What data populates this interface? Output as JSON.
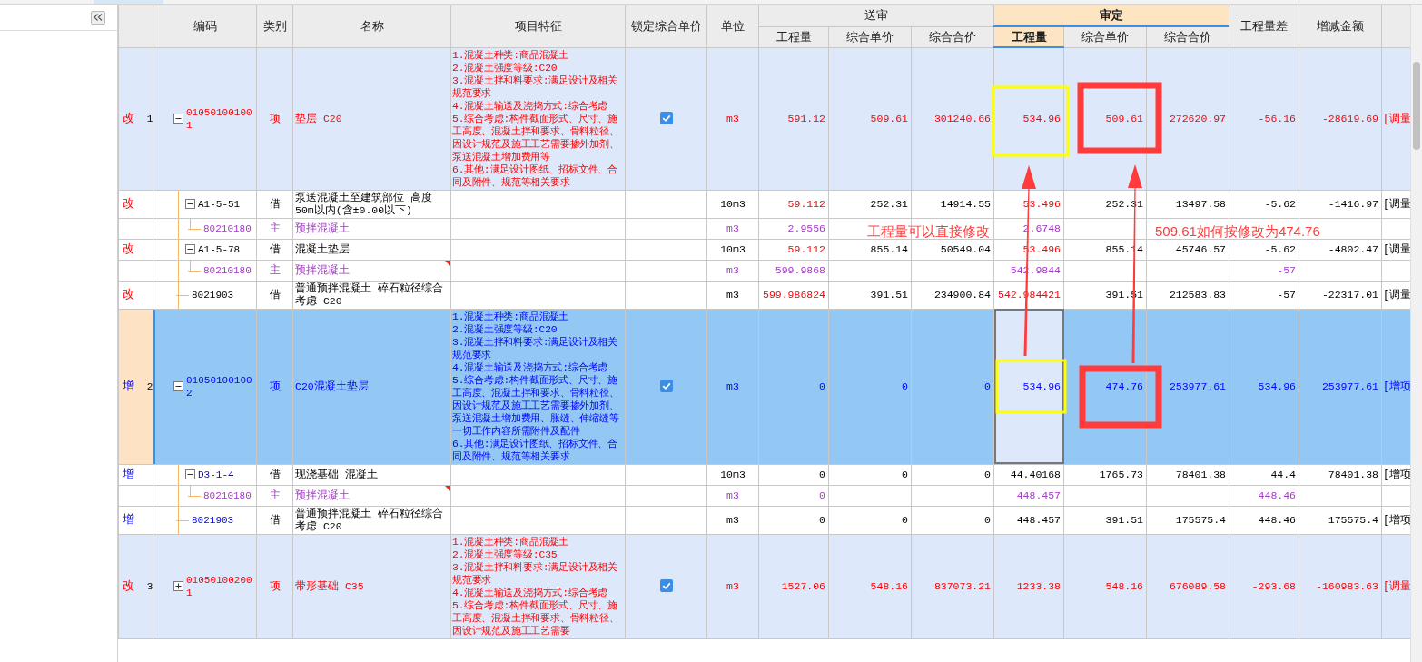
{
  "table": {
    "header": [
      {
        "kind": "single",
        "label": "编码"
      },
      {
        "kind": "single",
        "label": "类别"
      },
      {
        "kind": "single",
        "label": "名称"
      },
      {
        "kind": "single",
        "label": "项目特征"
      },
      {
        "kind": "single",
        "label": "锁定综合单价"
      },
      {
        "kind": "single",
        "label": "单位"
      },
      {
        "kind": "group",
        "label": "送审",
        "selected": false,
        "columns": [
          {
            "label": "工程量",
            "selected": false
          },
          {
            "label": "综合单价",
            "selected": false
          },
          {
            "label": "综合合价",
            "selected": false
          }
        ]
      },
      {
        "kind": "group",
        "label": "审定",
        "selected": true,
        "columns": [
          {
            "label": "工程量",
            "selected": true
          },
          {
            "label": "综合单价",
            "selected": false
          },
          {
            "label": "综合合价",
            "selected": false
          }
        ]
      },
      {
        "kind": "single",
        "label": "工程量差"
      },
      {
        "kind": "single",
        "label": "增减金额"
      }
    ],
    "rows": [
      {
        "kind": "item",
        "added": false,
        "mark": "改",
        "number": "1",
        "code": "010501001001",
        "type": "项",
        "name": "垫层 C20",
        "features": "1.混凝土种类:商品混凝土\n2.混凝土强度等级:C20\n3.混凝土拌和料要求:满足设计及相关规范要求\n4.混凝土输送及浇捣方式:综合考虑\n5.综合考虑:构件截面形式、尺寸、施工高度、混凝土拌和要求、骨料粒径、因设计规范及施工工艺需要掺外加剂、泵送混凝土增加费用等\n6.其他:满足设计图纸、招标文件、合同及附件、规范等相关要求",
        "locked": true,
        "unit": "m3",
        "values": {
          "review_qty": "591.12",
          "review_price": "509.61",
          "review_total": "301240.66",
          "approved_qty": "534.96",
          "approved_price": "509.61",
          "approved_total": "272620.97",
          "qty_diff": "-56.16",
          "amount_diff": "-28619.69"
        },
        "note": "[调量",
        "selected": false,
        "expanded": true,
        "children": [
          {
            "kind": "quota",
            "added": false,
            "mark": "改",
            "code": "A1-5-51",
            "type": "借",
            "name": "泵送混凝土至建筑部位 高度50m以内(含±0.00以下)",
            "unit": "10m3",
            "qty_changed": true,
            "values": {
              "review_qty": "59.112",
              "review_price": "252.31",
              "review_total": "14914.55",
              "approved_qty": "53.496",
              "approved_price": "252.31",
              "approved_total": "13497.58",
              "qty_diff": "-5.62",
              "amount_diff": "-1416.97"
            },
            "note": "[调量",
            "expanded": true,
            "children": [
              {
                "kind": "material",
                "code": "80210180",
                "type": "主",
                "name": "预拌混凝土",
                "unit": "m3",
                "values": {
                  "review_qty": "2.9556",
                  "approved_qty": "2.6748"
                }
              }
            ]
          },
          {
            "kind": "quota",
            "added": false,
            "mark": "改",
            "code": "A1-5-78",
            "type": "借",
            "name": "混凝土垫层",
            "unit": "10m3",
            "qty_changed": true,
            "values": {
              "review_qty": "59.112",
              "review_price": "855.14",
              "review_total": "50549.04",
              "approved_qty": "53.496",
              "approved_price": "855.14",
              "approved_total": "45746.57",
              "qty_diff": "-5.62",
              "amount_diff": "-4802.47"
            },
            "note": "[调量",
            "expanded": true,
            "children": [
              {
                "kind": "material",
                "code": "80210180",
                "type": "主",
                "name": "预拌混凝土",
                "unit": "m3",
                "flagged": true,
                "values": {
                  "review_qty": "599.9868",
                  "approved_qty": "542.9844",
                  "qty_diff": "-57"
                }
              }
            ]
          },
          {
            "kind": "quota",
            "added": false,
            "mark": "改",
            "code": "8021903",
            "type": "借",
            "name": "普通预拌混凝土 碎石粒径综合考虑 C20",
            "unit": "m3",
            "qty_changed": true,
            "values": {
              "review_qty": "599.986824",
              "review_price": "391.51",
              "review_total": "234900.84",
              "approved_qty": "542.984421",
              "approved_price": "391.51",
              "approved_total": "212583.83",
              "qty_diff": "-57",
              "amount_diff": "-22317.01"
            },
            "note": "[调量"
          }
        ]
      },
      {
        "kind": "item",
        "added": true,
        "mark": "增",
        "number": "2",
        "code": "010501001002",
        "type": "项",
        "name": "C20混凝土垫层",
        "features": "1.混凝土种类:商品混凝土\n2.混凝土强度等级:C20\n3.混凝土拌和料要求:满足设计及相关规范要求\n4.混凝土输送及浇捣方式:综合考虑\n5.综合考虑:构件截面形式、尺寸、施工高度、混凝土拌和要求、骨料粒径、因设计规范及施工工艺需要掺外加剂、泵送混凝土增加费用、胀缝、伸缩缝等一切工作内容所需附件及配件\n6.其他:满足设计图纸、招标文件、合同及附件、规范等相关要求",
        "locked": true,
        "unit": "m3",
        "values": {
          "review_qty": "0",
          "review_price": "0",
          "review_total": "0",
          "approved_qty": "534.96",
          "approved_price": "474.76",
          "approved_total": "253977.61",
          "qty_diff": "534.96",
          "amount_diff": "253977.61"
        },
        "note": "[增项",
        "selected": true,
        "expanded": true,
        "children": [
          {
            "kind": "quota",
            "added": true,
            "mark": "增",
            "code": "D3-1-4",
            "type": "借",
            "name": "现浇基础 混凝土",
            "unit": "10m3",
            "qty_changed": false,
            "values": {
              "review_qty": "0",
              "review_price": "0",
              "review_total": "0",
              "approved_qty": "44.40168",
              "approved_price": "1765.73",
              "approved_total": "78401.38",
              "qty_diff": "44.4",
              "amount_diff": "78401.38"
            },
            "note": "[增项",
            "expanded": true,
            "children": [
              {
                "kind": "material",
                "code": "80210180",
                "type": "主",
                "name": "预拌混凝土",
                "unit": "m3",
                "flagged": true,
                "values": {
                  "review_qty": "0",
                  "approved_qty": "448.457",
                  "qty_diff": "448.46"
                }
              }
            ]
          },
          {
            "kind": "quota",
            "added": true,
            "mark": "增",
            "code": "8021903",
            "type": "借",
            "name": "普通预拌混凝土 碎石粒径综合考虑 C20",
            "unit": "m3",
            "qty_changed": false,
            "values": {
              "review_qty": "0",
              "review_price": "0",
              "review_total": "0",
              "approved_qty": "448.457",
              "approved_price": "391.51",
              "approved_total": "175575.4",
              "qty_diff": "448.46",
              "amount_diff": "175575.4"
            },
            "note": "[增项"
          }
        ]
      },
      {
        "kind": "item",
        "added": false,
        "mark": "改",
        "number": "3",
        "code": "010501002001",
        "type": "项",
        "name": "带形基础 C35",
        "features": "1.混凝土种类:商品混凝土\n2.混凝土强度等级:C35\n3.混凝土拌和料要求:满足设计及相关规范要求\n4.混凝土输送及浇捣方式:综合考虑\n5.综合考虑:构件截面形式、尺寸、施工高度、混凝土拌和要求、骨料粒径、因设计规范及施工工艺需要",
        "locked": true,
        "unit": "m3",
        "values": {
          "review_qty": "1527.06",
          "review_price": "548.16",
          "review_total": "837073.21",
          "approved_qty": "1233.38",
          "approved_price": "548.16",
          "approved_total": "676089.58",
          "qty_diff": "-293.68",
          "amount_diff": "-160983.63"
        },
        "note": "[调量",
        "selected": false,
        "expanded": false
      }
    ]
  },
  "annotations": [
    {
      "text": "工程量可以直接修改"
    },
    {
      "text": "509.61如何按修改为474.76"
    }
  ]
}
